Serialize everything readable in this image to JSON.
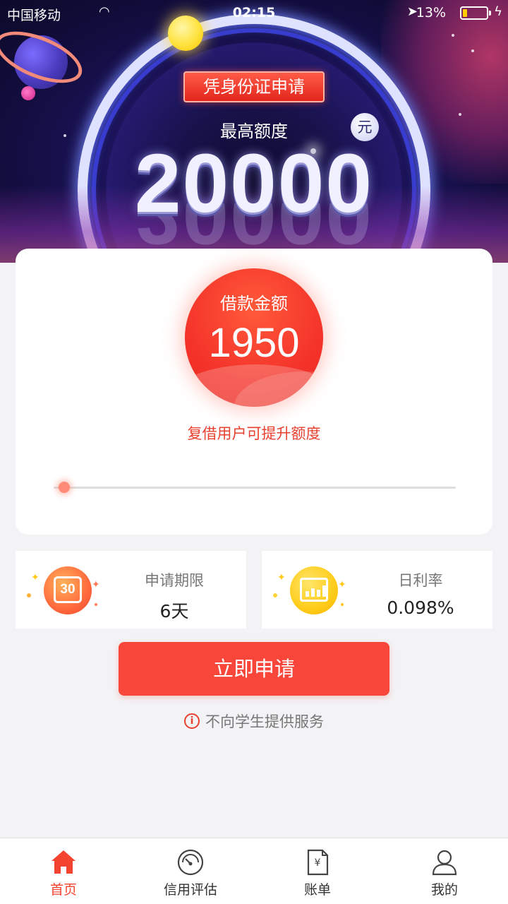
{
  "status_bar": {
    "carrier": "中国移动",
    "time": "02:15",
    "battery_percent": "13%"
  },
  "hero": {
    "badge": "凭身份证申请",
    "max_label": "最高额度",
    "max_amount": "20000",
    "unit": "元"
  },
  "loan": {
    "label": "借款金额",
    "amount": "1950",
    "hint": "复借用户可提升额度",
    "slider_fraction": 0.02
  },
  "term": {
    "icon_text": "30",
    "title": "申请期限",
    "value": "6天"
  },
  "rate": {
    "title": "日利率",
    "value": "0.098%"
  },
  "apply_button": "立即申请",
  "notice": {
    "icon": "i",
    "text": "不向学生提供服务"
  },
  "tabs": [
    {
      "label": "首页",
      "icon": "home-icon",
      "active": true
    },
    {
      "label": "信用评估",
      "icon": "gauge-icon",
      "active": false
    },
    {
      "label": "账单",
      "icon": "bill-icon",
      "active": false
    },
    {
      "label": "我的",
      "icon": "user-icon",
      "active": false
    }
  ],
  "colors": {
    "accent": "#f8473a",
    "tab_active": "#f4432f",
    "hint_red": "#e8402f"
  }
}
